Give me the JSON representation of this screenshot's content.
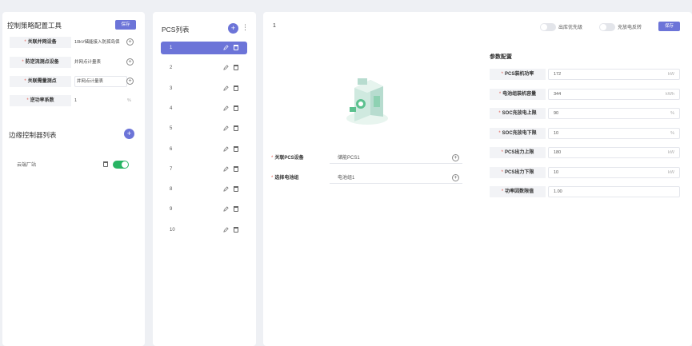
{
  "left": {
    "title": "控制策略配置工具",
    "save_label": "保存",
    "fields": [
      {
        "label": "关联并网设备",
        "value": "10kV储能接入防孤岛保",
        "boxed": false,
        "has_plus": true,
        "unit": ""
      },
      {
        "label": "防逆流测点设备",
        "value": "并网点计量表",
        "boxed": false,
        "has_plus": true,
        "unit": ""
      },
      {
        "label": "关联需量测点",
        "value": "并网点计量表",
        "boxed": true,
        "has_plus": true,
        "unit": ""
      },
      {
        "label": "逆功率系数",
        "value": "1",
        "boxed": false,
        "has_plus": false,
        "unit": "%"
      }
    ],
    "controller_title": "边缘控制器列表",
    "add_label": "+",
    "controllers": [
      {
        "name": "云端厂站",
        "enabled": true
      }
    ]
  },
  "mid": {
    "title": "PCS列表",
    "add_label": "+",
    "more_label": "⋮",
    "items": [
      "1",
      "2",
      "3",
      "4",
      "5",
      "6",
      "7",
      "8",
      "9",
      "10"
    ],
    "active_index": 0
  },
  "right": {
    "header_number": "1",
    "toggle1_label": "出库优先级",
    "toggle2_label": "充放电反转",
    "save_label": "保存",
    "selects": [
      {
        "label": "关联PCS设备",
        "value": "储能PCS1"
      },
      {
        "label": "选择电池组",
        "value": "电池组1"
      }
    ],
    "param_title": "参数配置",
    "params": [
      {
        "label": "PCS装机功率",
        "value": "172",
        "unit": "kW"
      },
      {
        "label": "电池组装机容量",
        "value": "344",
        "unit": "kWh"
      },
      {
        "label": "SOC充放电上限",
        "value": "90",
        "unit": "%"
      },
      {
        "label": "SOC充放电下限",
        "value": "10",
        "unit": "%"
      },
      {
        "label": "PCS出力上限",
        "value": "180",
        "unit": "kW"
      },
      {
        "label": "PCS出力下限",
        "value": "10",
        "unit": "kW"
      },
      {
        "label": "功率因数限值",
        "value": "1.00",
        "unit": ""
      }
    ]
  },
  "colors": {
    "accent": "#6c74d8",
    "toggle_on": "#28b463",
    "required": "#e0584f"
  }
}
